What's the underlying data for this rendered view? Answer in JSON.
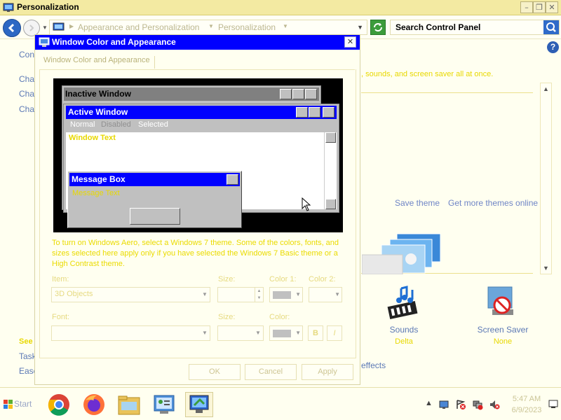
{
  "window": {
    "title": "Personalization"
  },
  "address": {
    "crumbs": [
      "Appearance and Personalization",
      "Personalization"
    ],
    "search_placeholder": "Search Control Panel"
  },
  "background": {
    "left_links": [
      "Cont",
      "Chan",
      "Chan",
      "Chan"
    ],
    "left_bottom": [
      "See",
      "Task",
      "Ease"
    ],
    "intro_fragment": ", sounds, and screen saver all at once.",
    "save_theme": "Save theme",
    "more_themes": "Get more themes online",
    "effects_fragment": "effects",
    "sounds_label": "Sounds",
    "sounds_value": "Delta",
    "screensaver_label": "Screen Saver",
    "screensaver_value": "None"
  },
  "dialog": {
    "title": "Window Color and Appearance",
    "tab": "Window Color and Appearance",
    "preview": {
      "inactive_title": "Inactive Window",
      "active_title": "Active Window",
      "menu_normal": "Normal",
      "menu_disabled": "Disabled",
      "menu_selected": "Selected",
      "window_text": "Window Text",
      "msgbox_title": "Message Box",
      "msgbox_text": "Message Text"
    },
    "note": "To turn on Windows Aero, select a Windows 7 theme. Some of the colors, fonts, and sizes selected here apply only if you have selected the Windows 7 Basic theme or a High Contrast theme.",
    "item_label": "Item:",
    "item_value": "3D Objects",
    "size_label": "Size:",
    "color1_label": "Color 1:",
    "color2_label": "Color 2:",
    "font_label": "Font:",
    "font_size_label": "Size:",
    "font_color_label": "Color:",
    "bold_label": "B",
    "italic_label": "I",
    "ok": "OK",
    "cancel": "Cancel",
    "apply": "Apply"
  },
  "taskbar": {
    "start": "Start",
    "time": "5:47 AM",
    "date": "6/9/2023"
  },
  "colors": {
    "dialog_title_bar": "#0000ff",
    "preview_background": "#000000",
    "inactive_title": "#808080",
    "window_text": "#e8d800"
  }
}
